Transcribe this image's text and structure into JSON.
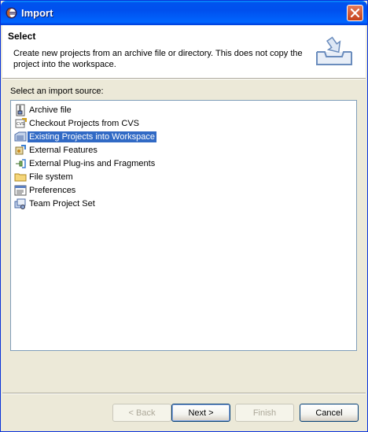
{
  "window": {
    "title": "Import"
  },
  "banner": {
    "title": "Select",
    "description": "Create new projects from an archive file or directory. This does not copy the project into the workspace."
  },
  "source_label": "Select an import source:",
  "sources": [
    {
      "label": "Archive file",
      "icon": "archive-file-icon",
      "selected": false
    },
    {
      "label": "Checkout Projects from CVS",
      "icon": "cvs-checkout-icon",
      "selected": false
    },
    {
      "label": "Existing Projects into Workspace",
      "icon": "existing-projects-icon",
      "selected": true
    },
    {
      "label": "External Features",
      "icon": "external-features-icon",
      "selected": false
    },
    {
      "label": "External Plug-ins and Fragments",
      "icon": "plugins-icon",
      "selected": false
    },
    {
      "label": "File system",
      "icon": "folder-icon",
      "selected": false
    },
    {
      "label": "Preferences",
      "icon": "preferences-icon",
      "selected": false
    },
    {
      "label": "Team Project Set",
      "icon": "team-project-set-icon",
      "selected": false
    }
  ],
  "buttons": {
    "back": {
      "label": "< Back",
      "enabled": false
    },
    "next": {
      "label": "Next >",
      "enabled": true
    },
    "finish": {
      "label": "Finish",
      "enabled": false
    },
    "cancel": {
      "label": "Cancel",
      "enabled": true
    }
  },
  "colors": {
    "selection": "#316ac5",
    "titlebar": "#0054e3"
  }
}
